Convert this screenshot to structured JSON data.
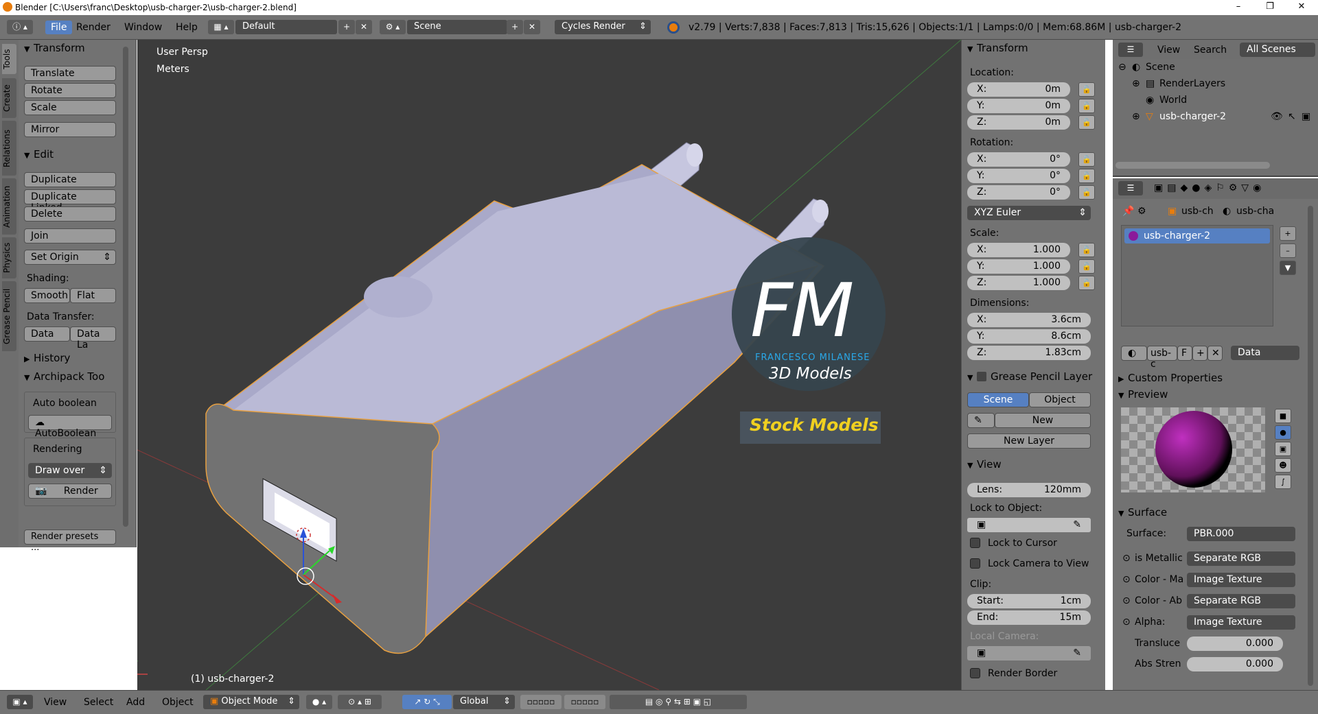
{
  "window": {
    "title": "Blender [C:\\Users\\franc\\Desktop\\usb-charger-2\\usb-charger-2.blend]",
    "controls": [
      "–",
      "❐",
      "✕"
    ]
  },
  "header": {
    "menus": [
      "File",
      "Render",
      "Window",
      "Help"
    ],
    "layout": "Default",
    "scene": "Scene",
    "engine": "Cycles Render",
    "stats": "v2.79 | Verts:7,838 | Faces:7,813 | Tris:15,626 | Objects:1/1 | Lamps:0/0 | Mem:68.86M | usb-charger-2"
  },
  "tool_tabs": [
    "Tools",
    "Create",
    "Relations",
    "Animation",
    "Physics",
    "Grease Pencil"
  ],
  "tool_panel": {
    "transform_title": "Transform",
    "translate": "Translate",
    "rotate": "Rotate",
    "scale": "Scale",
    "mirror": "Mirror",
    "edit_title": "Edit",
    "duplicate": "Duplicate",
    "duplicate_linked": "Duplicate Linked",
    "delete": "Delete",
    "join": "Join",
    "set_origin": "Set Origin",
    "shading_label": "Shading:",
    "smooth": "Smooth",
    "flat": "Flat",
    "data_transfer_label": "Data Transfer:",
    "data": "Data",
    "data_la": "Data La",
    "history_title": "History",
    "archipack_title": "Archipack Too",
    "auto_boolean_label": "Auto boolean",
    "autoboolean_btn": "AutoBoolean",
    "rendering_label": "Rendering",
    "draw_over": "Draw over",
    "render_btn": "Render",
    "render_presets": "Render presets ..."
  },
  "viewport": {
    "view_name": "User Persp",
    "units": "Meters",
    "object_label": "(1) usb-charger-2",
    "watermark_big": "FM",
    "watermark_name": "FRANCESCO MILANESE",
    "watermark_sub": "3D Models",
    "watermark_stock": "Stock Models"
  },
  "n_panel": {
    "transform_title": "Transform",
    "location_label": "Location:",
    "location": [
      {
        "k": "X:",
        "v": "0m"
      },
      {
        "k": "Y:",
        "v": "0m"
      },
      {
        "k": "Z:",
        "v": "0m"
      }
    ],
    "rotation_label": "Rotation:",
    "rotation": [
      {
        "k": "X:",
        "v": "0°"
      },
      {
        "k": "Y:",
        "v": "0°"
      },
      {
        "k": "Z:",
        "v": "0°"
      }
    ],
    "rotation_mode": "XYZ Euler",
    "scale_label": "Scale:",
    "scale": [
      {
        "k": "X:",
        "v": "1.000"
      },
      {
        "k": "Y:",
        "v": "1.000"
      },
      {
        "k": "Z:",
        "v": "1.000"
      }
    ],
    "dimensions_label": "Dimensions:",
    "dimensions": [
      {
        "k": "X:",
        "v": "3.6cm"
      },
      {
        "k": "Y:",
        "v": "8.6cm"
      },
      {
        "k": "Z:",
        "v": "1.83cm"
      }
    ],
    "grease_title": "Grease Pencil Layer",
    "gp_scene": "Scene",
    "gp_object": "Object",
    "gp_new": "New",
    "gp_new_layer": "New Layer",
    "view_title": "View",
    "lens_label": "Lens:",
    "lens_value": "120mm",
    "lock_to_object": "Lock to Object:",
    "lock_to_cursor": "Lock to Cursor",
    "lock_camera": "Lock Camera to View",
    "clip_label": "Clip:",
    "clip_start_k": "Start:",
    "clip_start_v": "1cm",
    "clip_end_k": "End:",
    "clip_end_v": "15m",
    "local_camera": "Local Camera:",
    "render_border": "Render Border"
  },
  "outliner": {
    "view": "View",
    "search": "Search",
    "all_scenes": "All Scenes",
    "items": [
      "Scene",
      "RenderLayers",
      "World",
      "usb-charger-2"
    ]
  },
  "properties": {
    "breadcrumb_1": "usb-ch",
    "breadcrumb_2": "usb-cha",
    "material_slot": "usb-charger-2",
    "mat_name": "usb-c",
    "mat_f": "F",
    "data_sel": "Data",
    "custom_props": "Custom Properties",
    "preview": "Preview",
    "surface_title": "Surface",
    "surface_label": "Surface:",
    "surface_value": "PBR.000",
    "rows": [
      {
        "k": "is Metallic",
        "v": "Separate RGB"
      },
      {
        "k": "Color - Ma",
        "v": "Image Texture"
      },
      {
        "k": "Color - Ab",
        "v": "Separate RGB"
      },
      {
        "k": "Alpha:",
        "v": "Image Texture"
      }
    ],
    "translucency_k": "Transluce",
    "translucency_v": "0.000",
    "abs_k": "Abs Stren",
    "abs_v": "0.000"
  },
  "bottom": {
    "menus": [
      "View",
      "Select",
      "Add",
      "Object"
    ],
    "mode": "Object Mode",
    "orientation": "Global"
  },
  "colors": {
    "accent": "#5680c2",
    "viewport_bg": "#3c3c3c",
    "panel_bg": "#727272",
    "selection_outline": "#e8a040"
  }
}
